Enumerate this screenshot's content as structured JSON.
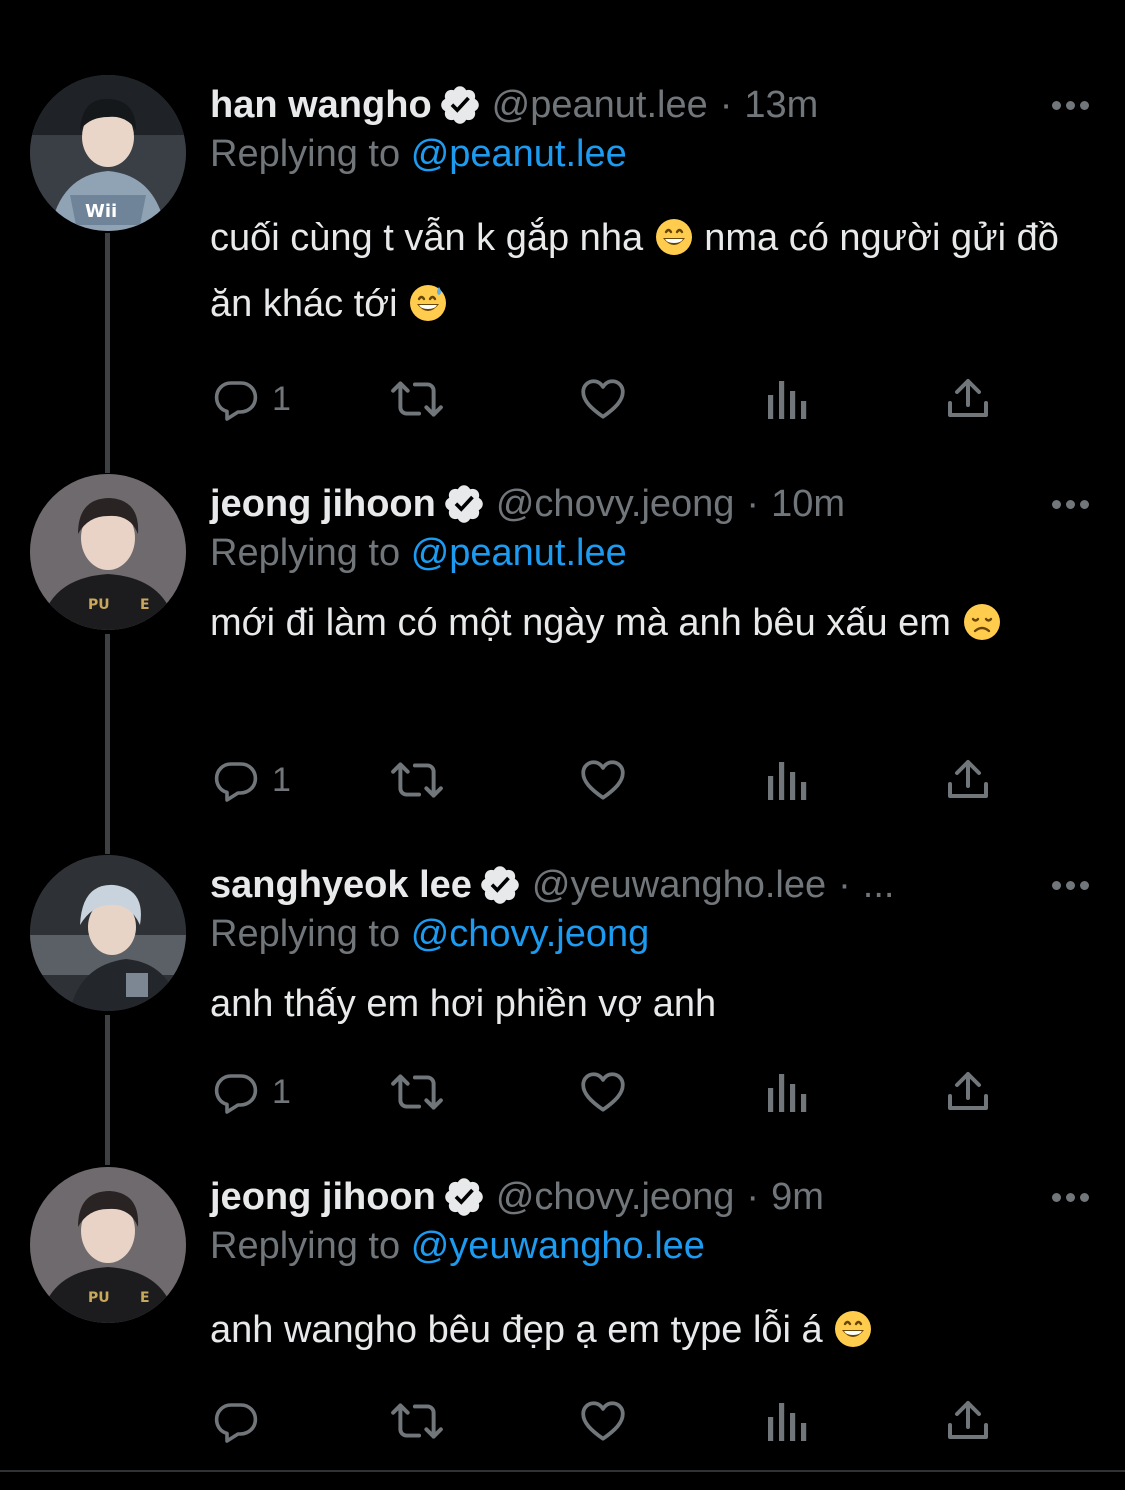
{
  "colors": {
    "background": "#000000",
    "text": "#e7e9ea",
    "muted": "#71767b",
    "accent": "#1d9bf0",
    "thread_line": "#3e4144"
  },
  "icons": {
    "verified": "verified-badge-icon",
    "reply": "reply-bubble-icon",
    "retweet": "retweet-icon",
    "like": "heart-icon",
    "views": "bar-chart-icon",
    "share": "share-upload-icon",
    "more": "more-dots-icon"
  },
  "tweets": [
    {
      "name": "han wangho",
      "handle": "@peanut.lee",
      "separator": "·",
      "time": "13m",
      "replying_prefix": "Replying to",
      "replying_to": "@peanut.lee",
      "text_1": "cuối cùng t vẫn k gắp nha",
      "emoji_1": "grinning-face-emoji",
      "text_2": "nma có người gửi đồ ăn khác tới",
      "emoji_2": "grinning-face-with-sweat-emoji",
      "reply_count": "1"
    },
    {
      "name": "jeong jihoon",
      "handle": "@chovy.jeong",
      "separator": "·",
      "time": "10m",
      "replying_prefix": "Replying to",
      "replying_to": "@peanut.lee",
      "text_1": "mới đi làm có một ngày mà anh bêu xấu em",
      "emoji_1": "disappointed-face-emoji",
      "reply_count": "1"
    },
    {
      "name": "sanghyeok lee",
      "handle": "@yeuwangho.lee",
      "separator": "·",
      "time": "...",
      "replying_prefix": "Replying to",
      "replying_to": "@chovy.jeong",
      "text_1": "anh thấy em hơi phiền vợ anh",
      "reply_count": "1"
    },
    {
      "name": "jeong jihoon",
      "handle": "@chovy.jeong",
      "separator": "·",
      "time": "9m",
      "replying_prefix": "Replying to",
      "replying_to": "@yeuwangho.lee",
      "text_1": "anh wangho bêu đẹp ạ em type lỗi á",
      "emoji_1": "grinning-face-emoji",
      "reply_count": ""
    }
  ]
}
